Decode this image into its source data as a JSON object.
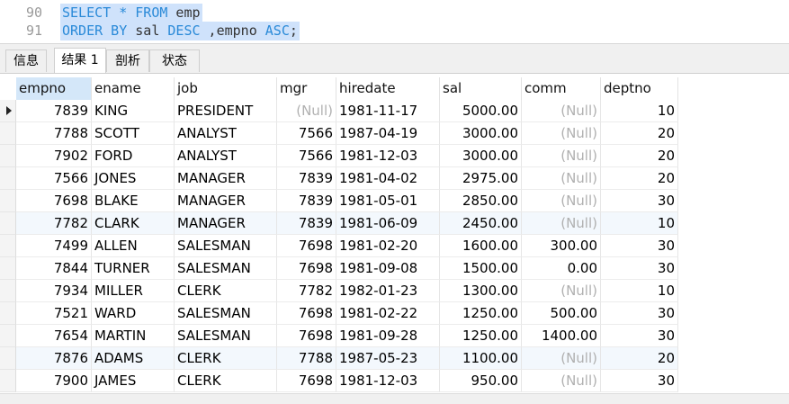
{
  "editor": {
    "lines": [
      {
        "num": "90",
        "tokens": [
          {
            "t": "SELECT",
            "kw": true
          },
          {
            "t": " * ",
            "kw": true
          },
          {
            "t": "FROM",
            "kw": true
          },
          {
            "t": " emp",
            "kw": false
          }
        ]
      },
      {
        "num": "91",
        "tokens": [
          {
            "t": "ORDER",
            "kw": true
          },
          {
            "t": " BY ",
            "kw": true
          },
          {
            "t": "sal ",
            "kw": false
          },
          {
            "t": "DESC",
            "kw": true
          },
          {
            "t": " ,empno ",
            "kw": false
          },
          {
            "t": "ASC",
            "kw": true
          },
          {
            "t": ";",
            "kw": false
          }
        ]
      }
    ]
  },
  "tabs": [
    "信息",
    "结果 1",
    "剖析",
    "状态"
  ],
  "active_tab": 1,
  "columns": [
    "empno",
    "ename",
    "job",
    "mgr",
    "hiredate",
    "sal",
    "comm",
    "deptno"
  ],
  "rows": [
    [
      "7839",
      "KING",
      "PRESIDENT",
      "(Null)",
      "1981-11-17",
      "5000.00",
      "(Null)",
      "10"
    ],
    [
      "7788",
      "SCOTT",
      "ANALYST",
      "7566",
      "1987-04-19",
      "3000.00",
      "(Null)",
      "20"
    ],
    [
      "7902",
      "FORD",
      "ANALYST",
      "7566",
      "1981-12-03",
      "3000.00",
      "(Null)",
      "20"
    ],
    [
      "7566",
      "JONES",
      "MANAGER",
      "7839",
      "1981-04-02",
      "2975.00",
      "(Null)",
      "20"
    ],
    [
      "7698",
      "BLAKE",
      "MANAGER",
      "7839",
      "1981-05-01",
      "2850.00",
      "(Null)",
      "30"
    ],
    [
      "7782",
      "CLARK",
      "MANAGER",
      "7839",
      "1981-06-09",
      "2450.00",
      "(Null)",
      "10"
    ],
    [
      "7499",
      "ALLEN",
      "SALESMAN",
      "7698",
      "1981-02-20",
      "1600.00",
      "300.00",
      "30"
    ],
    [
      "7844",
      "TURNER",
      "SALESMAN",
      "7698",
      "1981-09-08",
      "1500.00",
      "0.00",
      "30"
    ],
    [
      "7934",
      "MILLER",
      "CLERK",
      "7782",
      "1982-01-23",
      "1300.00",
      "(Null)",
      "10"
    ],
    [
      "7521",
      "WARD",
      "SALESMAN",
      "7698",
      "1981-02-22",
      "1250.00",
      "500.00",
      "30"
    ],
    [
      "7654",
      "MARTIN",
      "SALESMAN",
      "7698",
      "1981-09-28",
      "1250.00",
      "1400.00",
      "30"
    ],
    [
      "7876",
      "ADAMS",
      "CLERK",
      "7788",
      "1987-05-23",
      "1100.00",
      "(Null)",
      "20"
    ],
    [
      "7900",
      "JAMES",
      "CLERK",
      "7698",
      "1981-12-03",
      "950.00",
      "(Null)",
      "30"
    ]
  ],
  "colors": {
    "keyword": "#2a8ad8",
    "selection": "#cfe2fb",
    "null": "#b0b0b0"
  }
}
